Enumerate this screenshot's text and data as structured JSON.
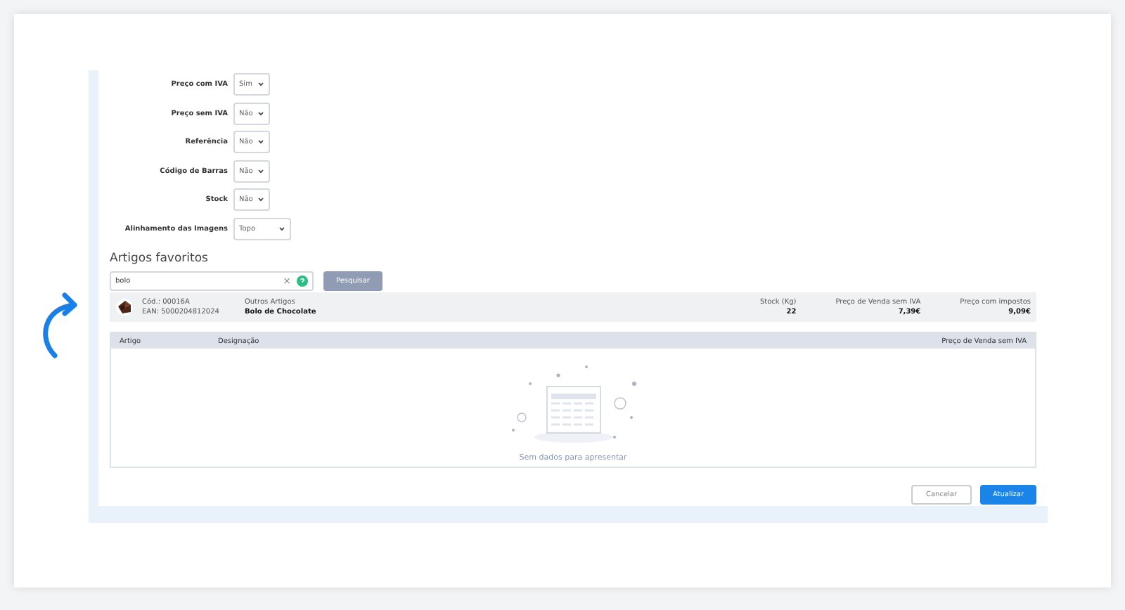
{
  "settings": [
    {
      "label": "Preço com IVA",
      "value": "Sim",
      "wide": false
    },
    {
      "label": "Preço sem IVA",
      "value": "Não",
      "wide": false
    },
    {
      "label": "Referência",
      "value": "Não",
      "wide": false
    },
    {
      "label": "Código de Barras",
      "value": "Não",
      "wide": false
    },
    {
      "label": "Stock",
      "value": "Não",
      "wide": false
    },
    {
      "label": "Alinhamento das Imagens",
      "value": "Topo",
      "wide": true
    }
  ],
  "favorites": {
    "title": "Artigos favoritos",
    "search": {
      "value": "bolo",
      "clear": "×"
    },
    "search_button": "Pesquisar",
    "result": {
      "code": "Cód.: 00016A",
      "ean": "EAN: 5000204812024",
      "family": "Outros Artigos",
      "name": "Bolo de Chocolate",
      "stats": [
        {
          "label": "Stock (Kg)",
          "value": "22"
        },
        {
          "label": "Preço de Venda sem IVA",
          "value": "7,39€"
        },
        {
          "label": "Preço com impostos",
          "value": "9,09€"
        }
      ]
    }
  },
  "table": {
    "columns": [
      "Artigo",
      "Designação",
      "Preço de Venda sem IVA"
    ],
    "empty_text": "Sem dados para apresentar"
  },
  "buttons": [
    {
      "label": "Cancelar",
      "kind": "secondary"
    },
    {
      "label": "Atualizar",
      "kind": "primary"
    }
  ]
}
